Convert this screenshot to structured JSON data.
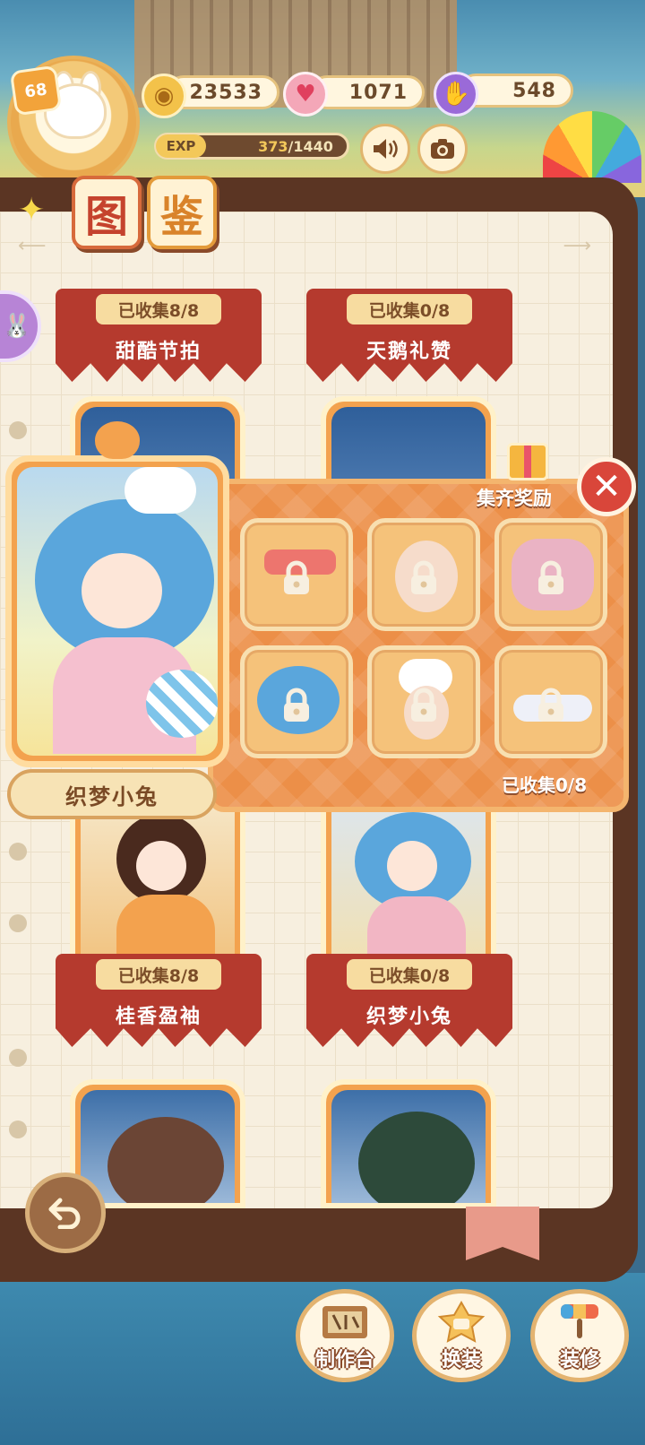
{
  "hud": {
    "level": "68",
    "coins": "23533",
    "hearts": "1071",
    "gems": "548",
    "exp_label": "EXP",
    "exp_current": "373",
    "exp_total": "/1440",
    "exp_progress": 0.259
  },
  "book": {
    "title_chars": [
      "图",
      "鉴"
    ],
    "collections": [
      {
        "badge": "已收集8/8",
        "name": "甜酷节拍"
      },
      {
        "badge": "已收集0/8",
        "name": "天鹅礼赞"
      },
      {
        "badge": "已收集8/8",
        "name": "桂香盈袖"
      },
      {
        "badge": "已收集0/8",
        "name": "织梦小兔"
      }
    ]
  },
  "popup": {
    "set_name": "织梦小兔",
    "reward_label": "集齐奖励",
    "collected_count": "已收集0/8",
    "close_icon": "✕"
  },
  "bottom_nav": [
    {
      "label": "制作台",
      "icon": "workbench-icon"
    },
    {
      "label": "换装",
      "icon": "wardrobe-icon"
    },
    {
      "label": "装修",
      "icon": "decorate-icon"
    }
  ],
  "colors": {
    "accent_orange": "#ec8f48",
    "stall_red": "#b53a2e",
    "book_brown": "#5b3523",
    "close_red": "#d9463a"
  }
}
